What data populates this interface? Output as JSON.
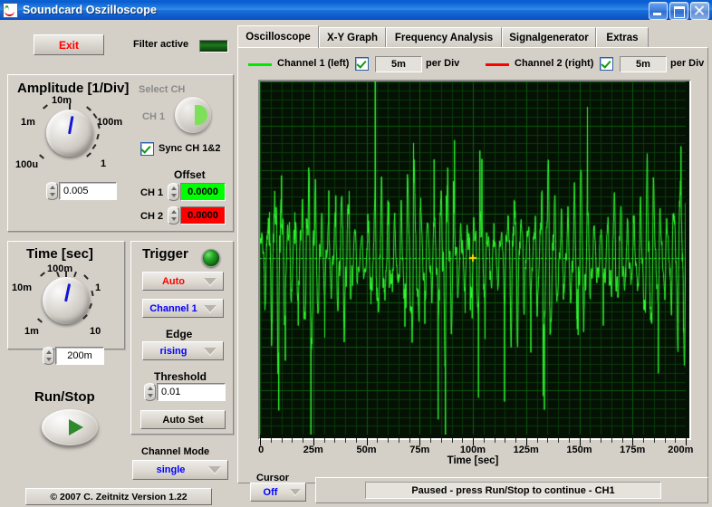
{
  "window": {
    "title": "Soundcard Oszilloscope",
    "icon": "oscilloscope-icon",
    "minimize_label": "_",
    "maximize_label": "□",
    "close_label": "×"
  },
  "toolbar": {
    "exit_label": "Exit",
    "filter_label": "Filter active",
    "filter_led_on": false
  },
  "amplitude": {
    "title": "Amplitude [1/Div]",
    "knob_labels": [
      "100u",
      "1m",
      "10m",
      "100m",
      "1"
    ],
    "value": "0.005",
    "select_ch_label": "Select CH",
    "ch_label": "CH 1",
    "sync_label": "Sync CH 1&2",
    "sync_checked": true,
    "offset_label": "Offset",
    "offset_ch1_label": "CH 1",
    "offset_ch1_value": "0.0000",
    "offset_ch1_color": "#00ff00",
    "offset_ch2_label": "CH 2",
    "offset_ch2_value": "0.0000",
    "offset_ch2_color": "#ff0000"
  },
  "time": {
    "title": "Time [sec]",
    "knob_labels": [
      "1m",
      "10m",
      "100m",
      "1",
      "10"
    ],
    "value": "200m"
  },
  "trigger": {
    "title": "Trigger",
    "led_on": true,
    "mode_value": "Auto",
    "mode_color": "#ff0000",
    "source_value": "Channel 1",
    "source_color": "#0000ff",
    "edge_label": "Edge",
    "edge_value": "rising",
    "edge_color": "#0000ff",
    "threshold_label": "Threshold",
    "threshold_value": "0.01",
    "autoset_label": "Auto Set"
  },
  "runstop": {
    "label": "Run/Stop"
  },
  "channel_mode": {
    "label": "Channel Mode",
    "value": "single",
    "value_color": "#0000ff"
  },
  "copyright": {
    "text": "© 2007   C. Zeitnitz Version 1.22"
  },
  "tabs": [
    {
      "label": "Oscilloscope",
      "active": true
    },
    {
      "label": "X-Y Graph",
      "active": false
    },
    {
      "label": "Frequency Analysis",
      "active": false
    },
    {
      "label": "Signalgenerator",
      "active": false
    },
    {
      "label": "Extras",
      "active": false
    }
  ],
  "channels": [
    {
      "name": "Channel 1 (left)",
      "color": "#00e800",
      "enabled": true,
      "per_div_value": "5m",
      "per_div_label": "per Div"
    },
    {
      "name": "Channel 2 (right)",
      "color": "#ff0000",
      "enabled": true,
      "per_div_value": "5m",
      "per_div_label": "per Div"
    }
  ],
  "cursor": {
    "label": "Cursor",
    "value": "Off",
    "value_color": "#0000ff"
  },
  "status": {
    "text": "Paused - press Run/Stop to continue - CH1"
  },
  "chart_data": {
    "type": "line",
    "title": "",
    "xlabel": "Time [sec]",
    "ylabel": "",
    "xlim": [
      0,
      0.2
    ],
    "xtick_labels": [
      "0",
      "25m",
      "50m",
      "75m",
      "100m",
      "125m",
      "150m",
      "175m",
      "200m"
    ],
    "xtick_values": [
      0,
      0.025,
      0.05,
      0.075,
      0.1,
      0.125,
      0.15,
      0.175,
      0.2
    ],
    "ylim": [
      -0.025,
      0.025
    ],
    "grid": true,
    "background": "#041104",
    "grid_color": "#0d5c0d",
    "minor_grid_color": "#0a3c0a",
    "divisions_x": 8,
    "divisions_y": 8,
    "series": [
      {
        "name": "Channel 1 (left)",
        "color": "#2fff2f",
        "carrier_hz": 320,
        "envelope_hz": 63,
        "envelope_depth": 0.62,
        "amplitude": 0.0118,
        "baseline": 0.0,
        "description": "Amplitude-modulated audio burst, dense green trace centered on zero line"
      },
      {
        "name": "Channel 2 (right)",
        "color": "#ff0000",
        "amplitude": 0.0,
        "visible": false,
        "description": "Channel 2 trace hidden behind channel 1"
      }
    ]
  }
}
